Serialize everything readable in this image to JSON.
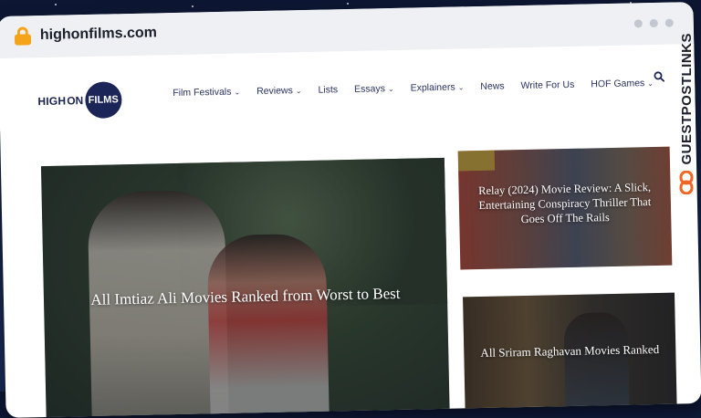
{
  "browser": {
    "url": "highonfilms.com"
  },
  "site": {
    "logo": {
      "part1": "HIGH",
      "part2": "ON",
      "part3": "FILMS"
    },
    "nav": [
      {
        "label": "Film Festivals",
        "has_dropdown": true
      },
      {
        "label": "Reviews",
        "has_dropdown": true
      },
      {
        "label": "Lists",
        "has_dropdown": false
      },
      {
        "label": "Essays",
        "has_dropdown": true
      },
      {
        "label": "Explainers",
        "has_dropdown": true
      },
      {
        "label": "News",
        "has_dropdown": false
      },
      {
        "label": "Write For Us",
        "has_dropdown": false
      },
      {
        "label": "HOF Games",
        "has_dropdown": true
      }
    ],
    "search_icon": "search-icon"
  },
  "articles": {
    "featured": {
      "title": "All Imtiaz Ali Movies Ranked from Worst to Best"
    },
    "side": [
      {
        "title": "Relay (2024) Movie Review: A Slick, Entertaining Conspiracy Thriller That Goes Off The Rails"
      },
      {
        "title": "All Sriram Raghavan Movies Ranked"
      }
    ]
  },
  "badge": {
    "text": "GUESTPOSTLINKS",
    "icon": "link-icon"
  },
  "colors": {
    "brand_navy": "#1c2557",
    "lock": "#f5a31a",
    "badge_orange": "#f26522"
  }
}
